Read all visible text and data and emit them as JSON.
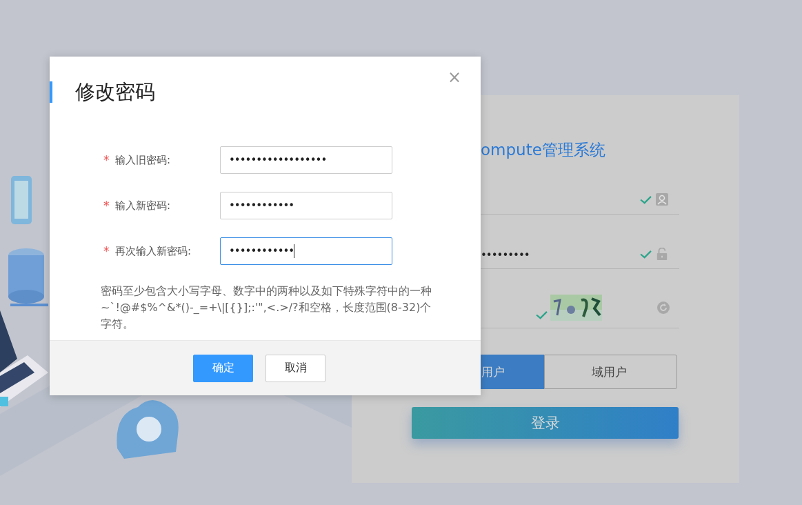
{
  "login_card": {
    "title": "ompute管理系统",
    "fields": [
      {
        "kind": "username",
        "valid": true
      },
      {
        "kind": "password",
        "value": "•••••••••",
        "valid": true
      },
      {
        "kind": "captcha",
        "valid": true
      }
    ],
    "user_tabs": [
      {
        "label": "用户",
        "selected": true
      },
      {
        "label": "域用户",
        "selected": false
      }
    ],
    "login_button": "登录"
  },
  "dialog": {
    "title": "修改密码",
    "close": "×",
    "fields": [
      {
        "required_mark": "*",
        "label": "输入旧密码:",
        "value": "••••••••••••••••••",
        "focused": false
      },
      {
        "required_mark": "*",
        "label": "输入新密码:",
        "value": "••••••••••••",
        "focused": false
      },
      {
        "required_mark": "*",
        "label": "再次输入新密码:",
        "value": "••••••••••••",
        "focused": true
      }
    ],
    "hint": "密码至少包含大小写字母、数字中的两种以及如下特殊字符中的一种 ~`!@#$%^&*()-_=+\\|[{}];:'\",<.>/?和空格，长度范围(8-32)个字符。",
    "buttons": [
      {
        "label": "确定",
        "kind": "primary"
      },
      {
        "label": "取消",
        "kind": "default"
      }
    ]
  }
}
